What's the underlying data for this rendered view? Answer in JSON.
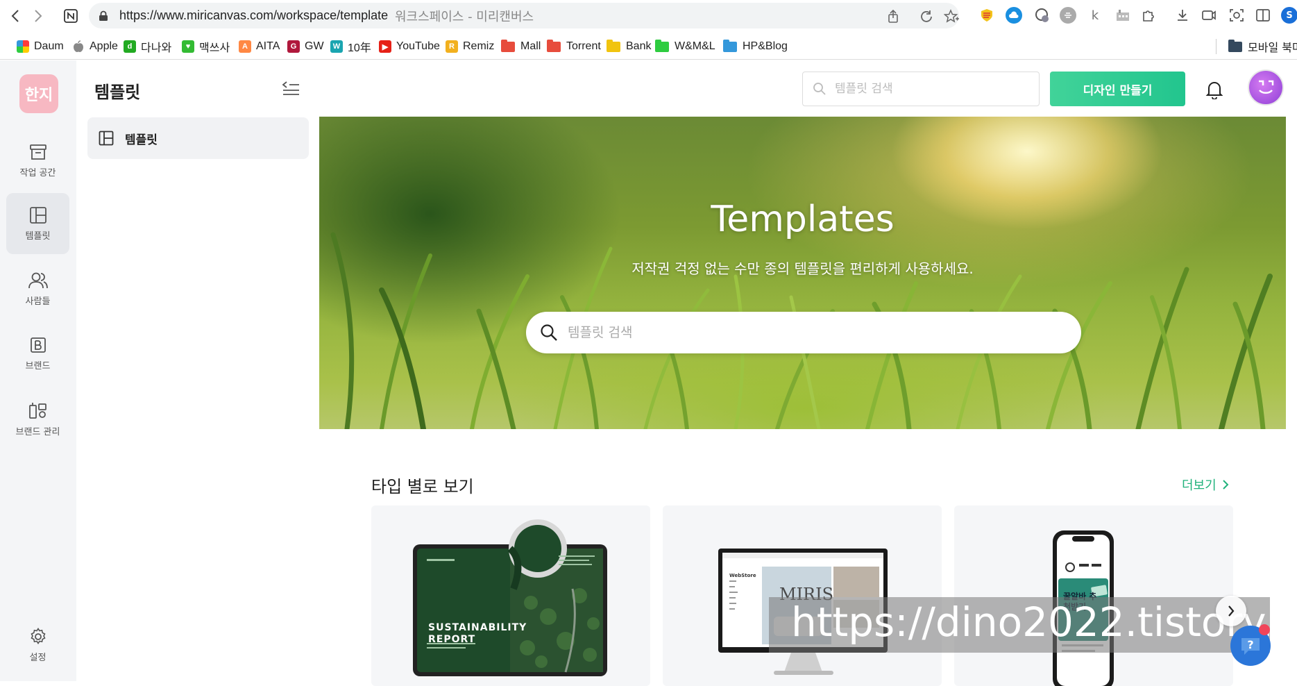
{
  "browser": {
    "url": "https://www.miricanvas.com/workspace/template",
    "page_title": "워크스페이스 - 미리캔버스",
    "bookmarks": [
      {
        "label": "Daum",
        "icon": "daum-icon",
        "color": "#ffcc00"
      },
      {
        "label": "Apple",
        "icon": "apple-icon",
        "color": "#888888"
      },
      {
        "label": "다나와",
        "icon": "danawa-icon",
        "color": "#22aa22"
      },
      {
        "label": "맥쓰사",
        "icon": "macsusa-icon",
        "color": "#33bb33"
      },
      {
        "label": "AITA",
        "icon": "aita-icon",
        "color": "#ff8844"
      },
      {
        "label": "GW",
        "icon": "gw-icon",
        "color": "#b0183c"
      },
      {
        "label": "10年",
        "icon": "tenyear-icon",
        "color": "#1aa5b0"
      },
      {
        "label": "YouTube",
        "icon": "youtube-icon",
        "color": "#e62117"
      },
      {
        "label": "Remiz",
        "icon": "remiz-icon",
        "color": "#f2b01e"
      },
      {
        "label": "Mall",
        "icon": "folder-icon",
        "color": "#e74c3c"
      },
      {
        "label": "Torrent",
        "icon": "folder-icon",
        "color": "#e74c3c"
      },
      {
        "label": "Bank",
        "icon": "folder-icon",
        "color": "#f1c40f"
      },
      {
        "label": "W&M&L",
        "icon": "folder-icon",
        "color": "#2ecc40"
      },
      {
        "label": "HP&Blog",
        "icon": "folder-icon",
        "color": "#3498db"
      }
    ],
    "mobile_bookmarks": "모바일 북마"
  },
  "rail": {
    "logo": "한지",
    "items": [
      {
        "label": "작업 공간",
        "icon": "archive-icon"
      },
      {
        "label": "템플릿",
        "icon": "template-icon",
        "active": true
      },
      {
        "label": "사람들",
        "icon": "people-icon"
      },
      {
        "label": "브랜드",
        "icon": "brand-icon"
      },
      {
        "label": "브랜드 관리",
        "icon": "brand-manage-icon"
      }
    ],
    "settings": "설정"
  },
  "panel": {
    "title": "템플릿",
    "item": "템플릿"
  },
  "topbar": {
    "search_placeholder": "템플릿 검색",
    "design_button": "디자인 만들기"
  },
  "hero": {
    "title": "Templates",
    "subtitle": "저작권 걱정 없는 수만 종의 템플릿을 편리하게 사용하세요.",
    "search_placeholder": "템플릿 검색"
  },
  "section": {
    "title": "타입 별로 보기",
    "more": "더보기"
  },
  "cards": [
    {
      "kind": "tablet",
      "headline": "SUSTAINABILITY REPORT"
    },
    {
      "kind": "monitor",
      "headline": "MIRIS",
      "store": "WebStore"
    },
    {
      "kind": "phone",
      "headline": "꿀알바 추천받기"
    }
  ],
  "watermark": "https://dino2022.tistory.com"
}
